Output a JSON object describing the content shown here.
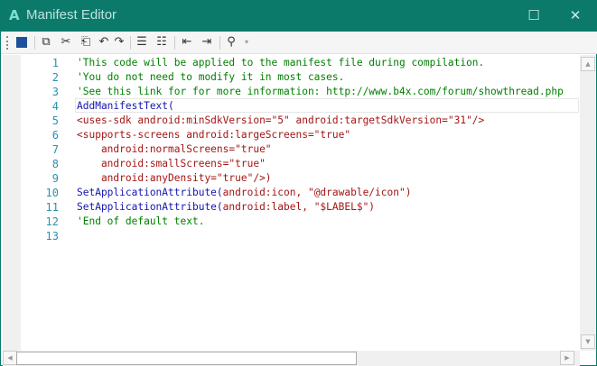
{
  "window": {
    "title": "Manifest Editor",
    "app_icon": "A",
    "minimize": "—",
    "maximize": "☐",
    "close": "✕"
  },
  "toolbar": {
    "icons": [
      "save-icon",
      "copy-icon",
      "cut-icon",
      "paste-icon",
      "undo-icon",
      "redo-icon",
      "comment-icon",
      "uncomment-icon",
      "outdent-icon",
      "indent-icon",
      "search-icon",
      "overflow-icon"
    ],
    "glyphs": {
      "save": "💾",
      "copy": "⧉",
      "cut": "✂",
      "paste": "📋",
      "undo": "↶",
      "redo": "↷",
      "comment": "☰",
      "uncomment": "☷",
      "outdent": "⇤",
      "indent": "⇥",
      "search": "⚲",
      "overflow": "▾"
    }
  },
  "editor": {
    "lines": [
      [
        {
          "t": "'This code will be applied to the manifest file during compilation.",
          "c": "c"
        }
      ],
      [
        {
          "t": "'You do not need to modify it in most cases.",
          "c": "c"
        }
      ],
      [
        {
          "t": "'See this link for for more information: http://www.b4x.com/forum/showthread.php",
          "c": "c"
        }
      ],
      [
        {
          "t": "AddManifestText(",
          "c": "k"
        }
      ],
      [
        {
          "t": "<uses-sdk android:minSdkVersion=\"5\" android:targetSdkVersion=\"31\"/>",
          "c": "r"
        }
      ],
      [
        {
          "t": "<supports-screens android:largeScreens=\"true\"",
          "c": "r"
        }
      ],
      [
        {
          "t": "    android:normalScreens=\"true\"",
          "c": "r"
        }
      ],
      [
        {
          "t": "    android:smallScreens=\"true\"",
          "c": "r"
        }
      ],
      [
        {
          "t": "    android:anyDensity=\"true\"/>)",
          "c": "r"
        }
      ],
      [
        {
          "t": "SetApplicationAttribute(",
          "c": "k"
        },
        {
          "t": "android:icon, \"@drawable/icon\")",
          "c": "r"
        }
      ],
      [
        {
          "t": "SetApplicationAttribute(",
          "c": "k"
        },
        {
          "t": "android:label, \"$LABEL$\")",
          "c": "r"
        }
      ],
      [
        {
          "t": "'End of default text.",
          "c": "c"
        }
      ],
      []
    ],
    "line_numbers": [
      "1",
      "2",
      "3",
      "4",
      "5",
      "6",
      "7",
      "8",
      "9",
      "10",
      "11",
      "12",
      "13"
    ]
  },
  "colors": {
    "titlebar": "#0b7a6b",
    "comment": "#008000",
    "keyword": "#1515b0",
    "string": "#a31515",
    "line_number": "#2b91af"
  }
}
